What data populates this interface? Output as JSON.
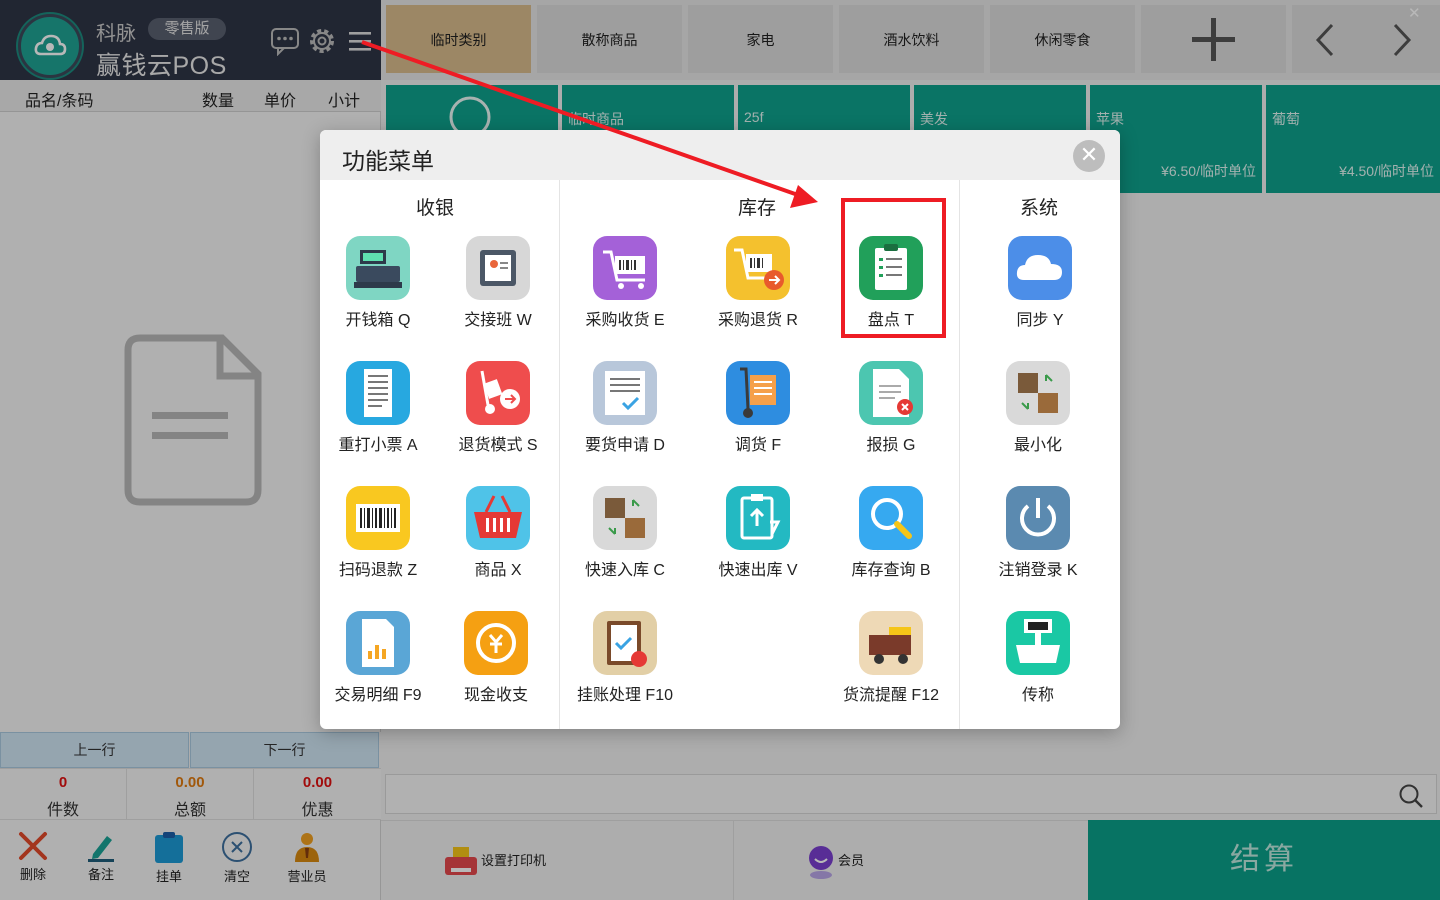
{
  "header": {
    "brand_company": "科脉",
    "edition": "零售版",
    "brand_product": "赢钱云POS"
  },
  "cart": {
    "columns": [
      "品名/条码",
      "数量",
      "单价",
      "小计"
    ],
    "nav": {
      "prev": "上一行",
      "next": "下一行"
    },
    "totals": [
      {
        "value": "0",
        "label": "件数",
        "color": "#e01010"
      },
      {
        "value": "0.00",
        "label": "总额",
        "color": "#e07a10"
      },
      {
        "value": "0.00",
        "label": "优惠",
        "color": "#e01010"
      }
    ],
    "actions": [
      {
        "label": "删除",
        "icon": "delete-x-icon"
      },
      {
        "label": "备注",
        "icon": "pen-icon"
      },
      {
        "label": "挂单",
        "icon": "clipboard-icon"
      },
      {
        "label": "清空",
        "icon": "clear-circle-icon"
      },
      {
        "label": "营业员",
        "icon": "salesperson-icon"
      }
    ]
  },
  "categories": [
    "临时类别",
    "散称商品",
    "家电",
    "酒水饮料",
    "休闲零食"
  ],
  "products": [
    {
      "name": "临时商品",
      "price": ""
    },
    {
      "name": "25f",
      "price": ""
    },
    {
      "name": "美发",
      "price": ""
    },
    {
      "name": "苹果",
      "price": "¥6.50/临时单位"
    },
    {
      "name": "葡萄",
      "price": "¥4.50/临时单位"
    }
  ],
  "bottom": {
    "printer": "设置打印机",
    "member": "会员",
    "checkout": "结算"
  },
  "menu": {
    "title": "功能菜单",
    "sections": {
      "cash": "收银",
      "inventory": "库存",
      "system": "系统"
    },
    "items": {
      "open_drawer": "开钱箱 Q",
      "shift": "交接班 W",
      "purchase_receive": "采购收货 E",
      "purchase_return": "采购退货 R",
      "stocktake": "盘点 T",
      "sync": "同步 Y",
      "reprint": "重打小票 A",
      "return_mode": "退货模式 S",
      "request": "要货申请 D",
      "transfer": "调货 F",
      "damage": "报损 G",
      "minimize": "最小化",
      "scan_refund": "扫码退款 Z",
      "goods": "商品 X",
      "quick_in": "快速入库 C",
      "quick_out": "快速出库 V",
      "stock_query": "库存查询 B",
      "logout": "注销登录 K",
      "transactions": "交易明细 F9",
      "cash_io": "现金收支",
      "credit": "挂账处理 F10",
      "logistics": "货流提醒 F12",
      "scale": "传称"
    }
  },
  "colors": {
    "teal": "#0fa18d",
    "highlight": "#ee1c24",
    "header_bg": "#2f3546"
  }
}
